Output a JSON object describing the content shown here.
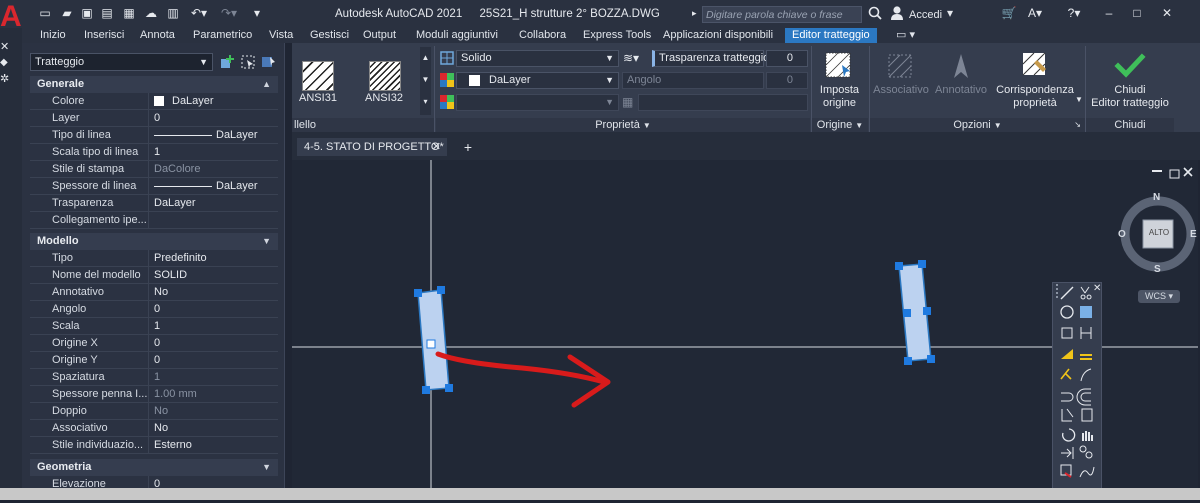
{
  "titlebar": {
    "app_name": "Autodesk AutoCAD 2021",
    "file_name": "25S21_H strutture 2° BOZZA.DWG",
    "search_placeholder": "Digitare parola chiave o frase",
    "signin": "Accedi"
  },
  "ribbon_tabs": [
    "Inizio",
    "Inserisci",
    "Annota",
    "Parametrico",
    "Vista",
    "Gestisci",
    "Output",
    "Moduli aggiuntivi",
    "Collabora",
    "Express Tools",
    "Applicazioni disponibili",
    "Editor tratteggio"
  ],
  "ribbon": {
    "patterns": [
      "ANSI31",
      "ANSI32"
    ],
    "pattern_panel_label": "llello",
    "hatch_type": "Solido",
    "transparency_label": "Trasparenza tratteggio",
    "transparency_value": "0",
    "color_value": "DaLayer",
    "angle_label": "Angolo",
    "angle_value": "0",
    "properties_label": "Proprietà",
    "set_origin_line1": "Imposta",
    "set_origin_line2": "origine",
    "origin_label": "Origine",
    "associative": "Associativo",
    "annotative": "Annotativo",
    "match_line1": "Corrispondenza",
    "match_line2": "proprietà",
    "options_label": "Opzioni",
    "close_line1": "Chiudi",
    "close_line2": "Editor tratteggio",
    "close_label": "Chiudi"
  },
  "file_tab": "4-5. STATO DI PROGETTO*",
  "palette": {
    "selection": "Tratteggio",
    "sections": {
      "generale": "Generale",
      "modello": "Modello",
      "geometria": "Geometria"
    },
    "generale_rows": [
      {
        "label": "Colore",
        "value": "DaLayer"
      },
      {
        "label": "Layer",
        "value": "0"
      },
      {
        "label": "Tipo di linea",
        "value": "DaLayer"
      },
      {
        "label": "Scala tipo di linea",
        "value": "1"
      },
      {
        "label": "Stile di stampa",
        "value": "DaColore"
      },
      {
        "label": "Spessore di linea",
        "value": "DaLayer"
      },
      {
        "label": "Trasparenza",
        "value": "DaLayer"
      },
      {
        "label": "Collegamento  ipe...",
        "value": ""
      }
    ],
    "modello_rows": [
      {
        "label": "Tipo",
        "value": "Predefinito"
      },
      {
        "label": "Nome del modello",
        "value": "SOLID"
      },
      {
        "label": "Annotativo",
        "value": "No"
      },
      {
        "label": "Angolo",
        "value": "0"
      },
      {
        "label": "Scala",
        "value": "1"
      },
      {
        "label": "Origine X",
        "value": "0"
      },
      {
        "label": "Origine Y",
        "value": "0"
      },
      {
        "label": "Spaziatura",
        "value": "1"
      },
      {
        "label": "Spessore  penna  I...",
        "value": "1.00 mm"
      },
      {
        "label": "Doppio",
        "value": "No"
      },
      {
        "label": "Associativo",
        "value": "No"
      },
      {
        "label": "Stile  individuazio...",
        "value": "Esterno"
      }
    ],
    "geometria_rows": [
      {
        "label": "Elevazione",
        "value": "0"
      }
    ]
  },
  "viewcube": {
    "north": "N",
    "south": "S",
    "east": "E",
    "west": "O",
    "top": "ALTO",
    "wcs": "WCS"
  },
  "colors": {
    "accent": "#2b78c2",
    "hatch_fill": "#bcd2f0",
    "grip": "#1f7ae0",
    "annotation_arrow": "#d81b1b",
    "check": "#3fbf5a"
  }
}
